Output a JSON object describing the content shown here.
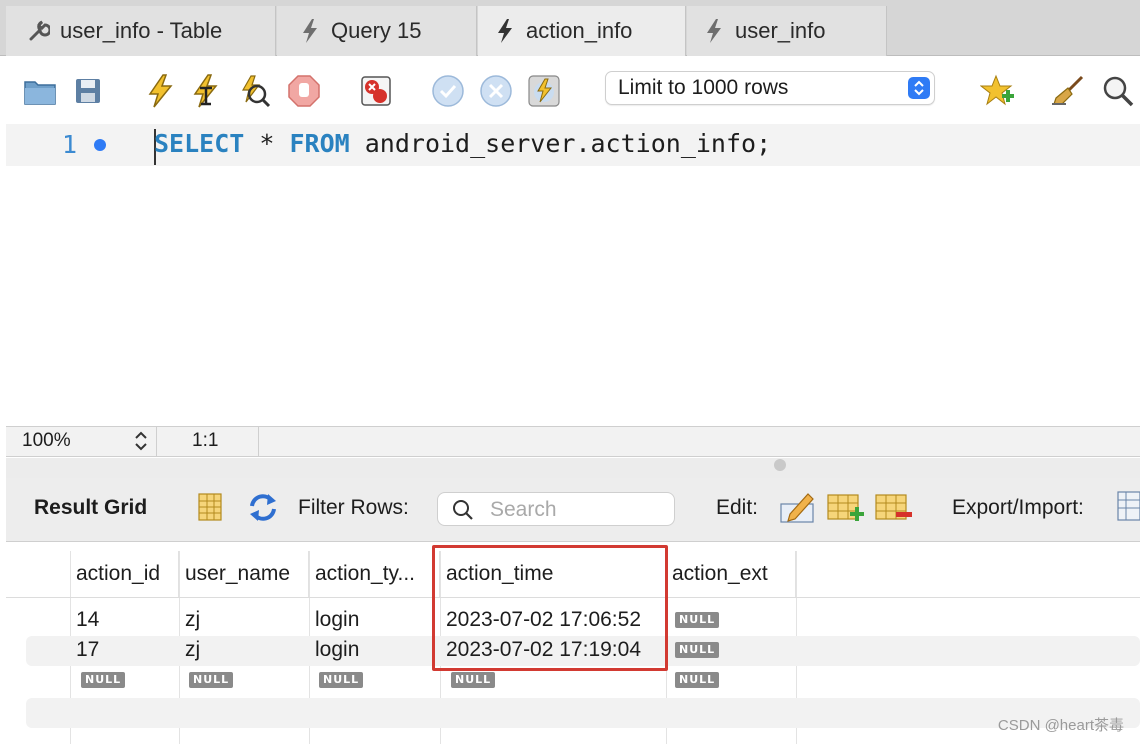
{
  "tabs": [
    {
      "label": "user_info - Table",
      "icon": "wrench-icon",
      "active": false
    },
    {
      "label": "Query 15",
      "icon": "lightning-icon",
      "active": false
    },
    {
      "label": "action_info",
      "icon": "lightning-icon",
      "active": true
    },
    {
      "label": "user_info",
      "icon": "lightning-icon",
      "active": false
    }
  ],
  "toolbar": {
    "limit_label": "Limit to 1000 rows"
  },
  "editor": {
    "line_number": "1",
    "kw_select": "SELECT",
    "star": " * ",
    "kw_from": "FROM",
    "rest": " android_server.action_info;"
  },
  "status": {
    "zoom": "100%",
    "cursor": "1:1"
  },
  "result": {
    "title": "Result Grid",
    "filter_label": "Filter Rows:",
    "search_placeholder": "Search",
    "edit_label": "Edit:",
    "export_label": "Export/Import:"
  },
  "grid": {
    "columns": [
      "action_id",
      "user_name",
      "action_ty...",
      "action_time",
      "action_ext"
    ],
    "rows": [
      [
        "14",
        "zj",
        "login",
        "2023-07-02 17:06:52",
        "NULL"
      ],
      [
        "17",
        "zj",
        "login",
        "2023-07-02 17:19:04",
        "NULL"
      ],
      [
        "NULL",
        "NULL",
        "NULL",
        "NULL",
        "NULL"
      ]
    ]
  },
  "watermark": "CSDN @heart茶毒",
  "colors": {
    "keyword": "#2a82c0",
    "highlight_border": "#d23a32",
    "accent_blue": "#2f7bf5"
  }
}
